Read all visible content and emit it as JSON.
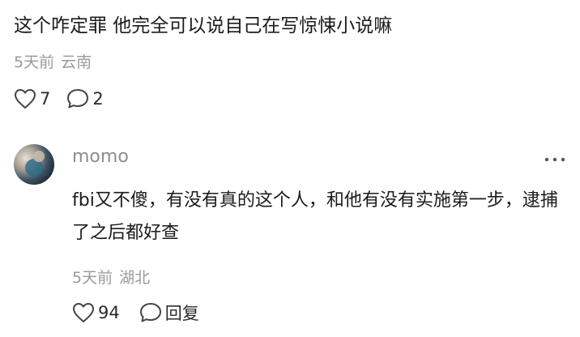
{
  "top_comment": {
    "text": "这个咋定罪 他完全可以说自己在写惊悚小说嘛",
    "time": "5天前",
    "location": "云南",
    "likes": "7",
    "replies": "2",
    "like_icon": "heart-outline-icon",
    "reply_icon": "speech-bubble-icon"
  },
  "reply": {
    "username": "momo",
    "text": "fbi又不傻，有没有真的这个人，和他有没有实施第一步，逮捕了之后都好查",
    "time": "5天前",
    "location": "湖北",
    "likes": "94",
    "reply_label": "回复",
    "more_icon": "ellipsis-icon",
    "avatar_icon": "avatar"
  },
  "colors": {
    "text": "#1b1b1b",
    "muted": "#9a9a9a",
    "username": "#8c8c8c",
    "icon": "#444444"
  }
}
